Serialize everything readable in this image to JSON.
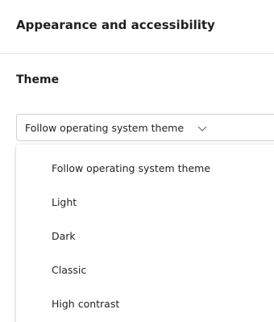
{
  "section": {
    "title": "Appearance and accessibility"
  },
  "theme": {
    "label": "Theme",
    "selected": "Follow operating system theme",
    "options": [
      "Follow operating system theme",
      "Light",
      "Dark",
      "Classic",
      "High contrast"
    ]
  },
  "icons": {
    "dropdown": "chevron-down-icon"
  }
}
